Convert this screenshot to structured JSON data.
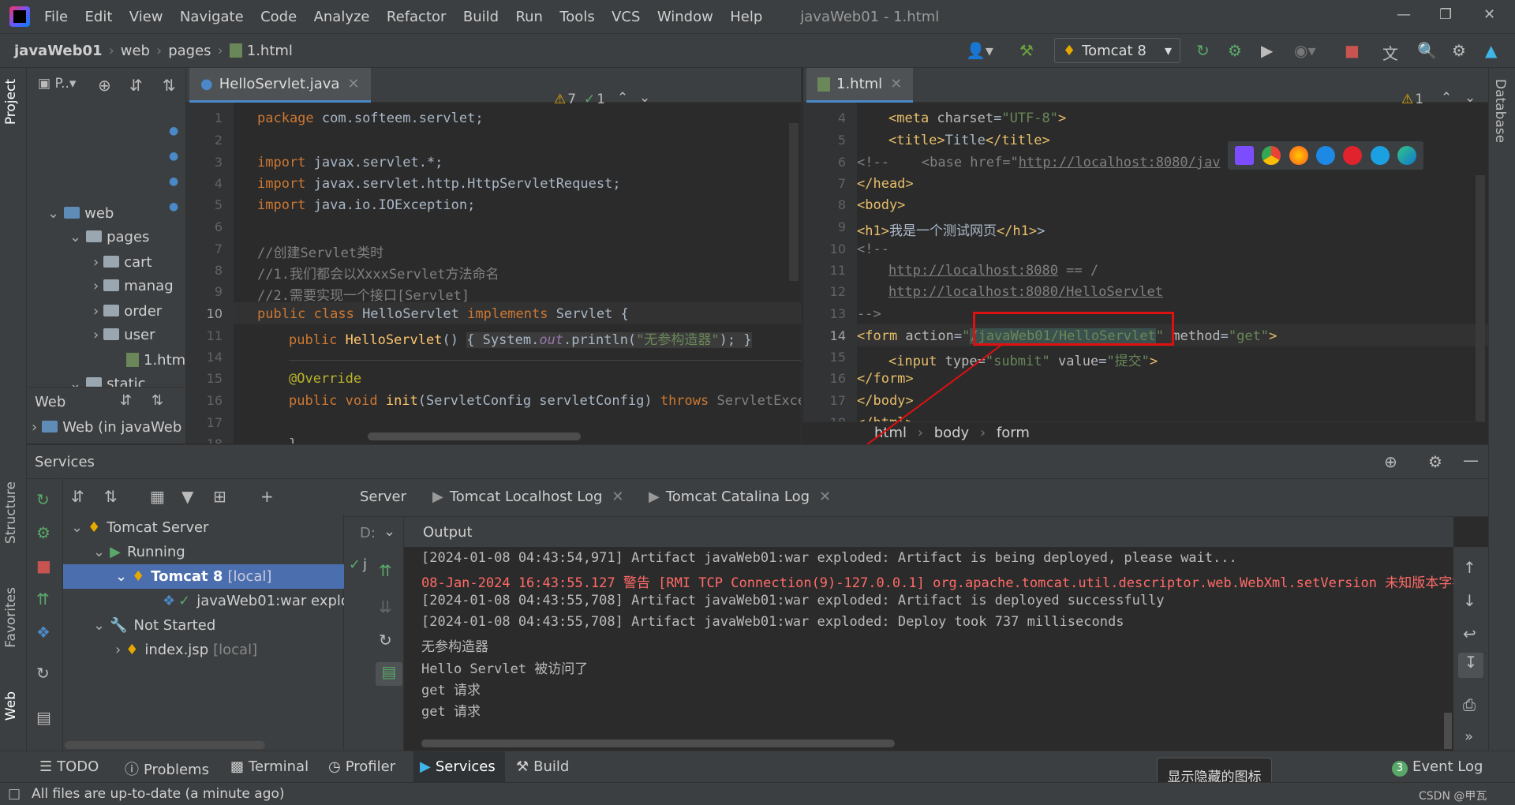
{
  "window": {
    "title": "javaWeb01 - 1.html",
    "menu": [
      "File",
      "Edit",
      "View",
      "Navigate",
      "Code",
      "Analyze",
      "Refactor",
      "Build",
      "Run",
      "Tools",
      "VCS",
      "Window",
      "Help"
    ]
  },
  "breadcrumb": [
    "javaWeb01",
    "web",
    "pages",
    "1.html"
  ],
  "toolbar": {
    "run_config": "Tomcat 8"
  },
  "left_strip": {
    "project": "Project",
    "structure": "Structure",
    "favorites": "Favorites",
    "web": "Web"
  },
  "right_strip": {
    "database": "Database"
  },
  "project": {
    "header": "P..",
    "tree": [
      {
        "label": "web"
      },
      {
        "label": "pages"
      },
      {
        "label": "cart"
      },
      {
        "label": "manag"
      },
      {
        "label": "order"
      },
      {
        "label": "user"
      },
      {
        "label": "1.htm"
      },
      {
        "label": "static"
      }
    ],
    "web_section": "Web",
    "web_item": "Web (in javaWeb"
  },
  "editor1": {
    "tab": "HelloServlet.java",
    "warnings": "7",
    "checks": "1",
    "lines": [
      {
        "n": "1"
      },
      {
        "n": "2"
      },
      {
        "n": "3"
      },
      {
        "n": "4"
      },
      {
        "n": "5"
      },
      {
        "n": "6"
      },
      {
        "n": "7"
      },
      {
        "n": "8"
      },
      {
        "n": "9"
      },
      {
        "n": "10"
      },
      {
        "n": "11"
      },
      {
        "n": "14"
      },
      {
        "n": "15"
      },
      {
        "n": "16"
      },
      {
        "n": "17"
      },
      {
        "n": "18"
      }
    ],
    "code": {
      "l1": "com.softeem.servlet;",
      "l3": "javax.servlet.*;",
      "l4": "javax.servlet.http.HttpServletRequest;",
      "l5": "java.io.IOException;",
      "l7": "//创建Servlet类时",
      "l8": "//1.我们都会以XxxxServlet方法命名",
      "l9": "//2.需要实现一个接口[Servlet]",
      "l10_name": "HelloServlet",
      "l10_iface": "Servlet {",
      "l11_ctor": "HelloServlet",
      "l11_str": "\"无参构造器\"",
      "l15": "@Override",
      "l16_fn": "init",
      "l16_args": "(ServletConfig servletConfig)",
      "l16_throws": "ServletExcep",
      "l18": "}"
    }
  },
  "editor2": {
    "tab": "1.html",
    "warnings": "1",
    "lines": [
      {
        "n": "4"
      },
      {
        "n": "5"
      },
      {
        "n": "6"
      },
      {
        "n": "7"
      },
      {
        "n": "8"
      },
      {
        "n": "9"
      },
      {
        "n": "10"
      },
      {
        "n": "11"
      },
      {
        "n": "12"
      },
      {
        "n": "13"
      },
      {
        "n": "14"
      },
      {
        "n": "15"
      },
      {
        "n": "16"
      },
      {
        "n": "17"
      },
      {
        "n": "18"
      }
    ],
    "code": {
      "l4": "\"UTF-8\"",
      "l5_text": "Title",
      "l6_comment": "<!--    <base href=\"",
      "l6_url": "http://localhost:8080/jav",
      "l9_text": "我是一个测试网页",
      "l10": "<!--",
      "l11_url": "http://localhost:8080",
      "l11_rest": " == /",
      "l12_url": "http://localhost:8080/HelloServlet",
      "l13": "-->",
      "l14_action": "/javaWeb01/HelloServlet",
      "l14_method": "\"get\"",
      "l15_type": "\"submit\"",
      "l15_value": "\"提交\""
    },
    "breadcrumb": [
      "html",
      "body",
      "form"
    ]
  },
  "services": {
    "title": "Services",
    "tree": {
      "tomcat_server": "Tomcat Server",
      "running": "Running",
      "tomcat8": "Tomcat 8",
      "tomcat8_suffix": "[local]",
      "artifact": "javaWeb01:war explo",
      "not_started": "Not Started",
      "index": "index.jsp",
      "index_suffix": "[local]"
    },
    "subtabs": [
      "Server",
      "Tomcat Localhost Log",
      "Tomcat Catalina Log"
    ],
    "deploy_label": "D:",
    "output_label": "Output",
    "console": [
      {
        "text": "[2024-01-08 04:43:54,971] Artifact javaWeb01:war exploded: Artifact is being deployed, please wait...",
        "err": false
      },
      {
        "text": "08-Jan-2024 16:43:55.127 警告 [RMI TCP Connection(9)-127.0.0.1] org.apache.tomcat.util.descriptor.web.WebXml.setVersion 未知版本字符串",
        "err": true
      },
      {
        "text": "[2024-01-08 04:43:55,708] Artifact javaWeb01:war exploded: Artifact is deployed successfully",
        "err": false
      },
      {
        "text": "[2024-01-08 04:43:55,708] Artifact javaWeb01:war exploded: Deploy took 737 milliseconds",
        "err": false
      },
      {
        "text": "无参构造器",
        "err": false
      },
      {
        "text": "Hello Servlet 被访问了",
        "err": false
      },
      {
        "text": "get 请求",
        "err": false
      },
      {
        "text": "get 请求",
        "err": false
      }
    ]
  },
  "bottom_tabs": [
    "TODO",
    "Problems",
    "Terminal",
    "Profiler",
    "Services",
    "Build"
  ],
  "event_log": {
    "label": "Event Log",
    "count": "3"
  },
  "status": {
    "message": "All files are up-to-date (a minute ago)",
    "watermark": "CSDN @甲瓦"
  },
  "tooltip": "显示隐藏的图标",
  "colors": {
    "accent": "#4a88c7",
    "highlight_box": "#e01010",
    "arrow": "#e01010"
  }
}
